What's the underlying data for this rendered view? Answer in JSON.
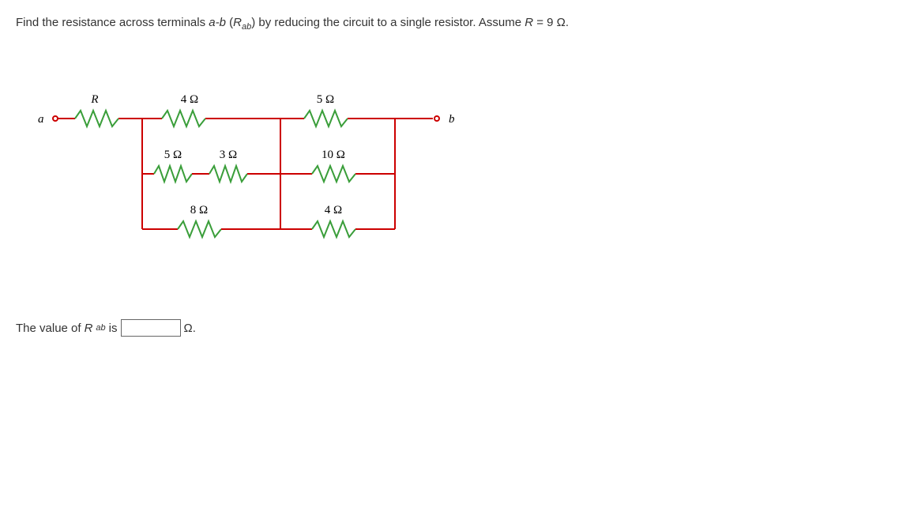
{
  "question": {
    "text_pre": "Find the resistance across terminals ",
    "ab": "a-b",
    "paren_open": " (",
    "Rab": "R",
    "Rab_sub": "ab",
    "paren_close": ")",
    "text_mid": " by reducing the circuit to a single resistor. Assume ",
    "Rvar": "R",
    "eq": " = ",
    "Rval": "9",
    "unit": " Ω."
  },
  "diagram": {
    "terminal_a": "a",
    "terminal_b": "b",
    "R_label": "R",
    "r_4": "4 Ω",
    "r_5_top": "5 Ω",
    "r_5_left": "5 Ω",
    "r_3": "3 Ω",
    "r_10": "10 Ω",
    "r_8": "8 Ω",
    "r_4b": "4 Ω"
  },
  "answer": {
    "text_pre": "The value of ",
    "Rab": "R",
    "Rab_sub": "ab",
    "text_mid": " is",
    "unit": "Ω."
  }
}
